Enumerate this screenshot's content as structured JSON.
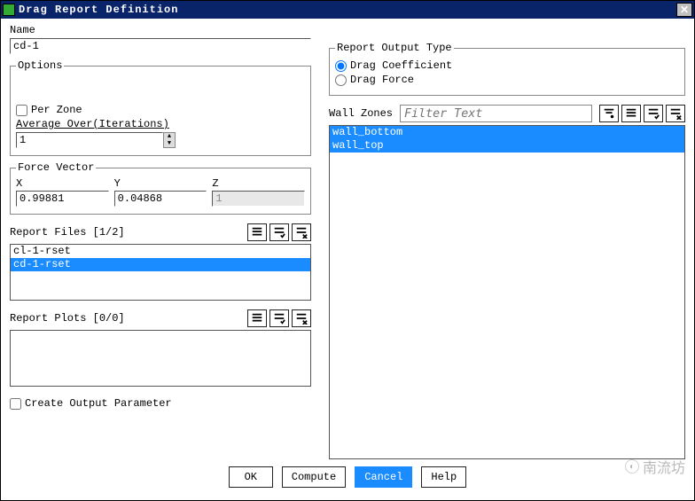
{
  "window": {
    "title": "Drag Report Definition"
  },
  "name": {
    "label": "Name",
    "value": "cd-1"
  },
  "options": {
    "legend": "Options",
    "per_zone_label": "Per Zone",
    "per_zone_checked": false,
    "avg_over_label": "Average Over(Iterations)",
    "avg_over_value": "1"
  },
  "force_vector": {
    "legend": "Force Vector",
    "x_label": "X",
    "x_value": "0.99881",
    "y_label": "Y",
    "y_value": "0.04868",
    "z_label": "Z",
    "z_value": "1"
  },
  "report_files": {
    "header": "Report Files [1/2]",
    "items": [
      "cl-1-rset",
      "cd-1-rset"
    ],
    "selected_index": 1
  },
  "report_plots": {
    "header": "Report Plots [0/0]",
    "items": []
  },
  "create_output_param": {
    "label": "Create Output Parameter",
    "checked": false
  },
  "output_type": {
    "legend": "Report Output Type",
    "opts": [
      "Drag Coefficient",
      "Drag Force"
    ],
    "selected_index": 0
  },
  "wall_zones": {
    "label": "Wall Zones",
    "filter_placeholder": "Filter Text",
    "items": [
      "wall_bottom",
      "wall_top"
    ],
    "selected": [
      0,
      1
    ]
  },
  "buttons": {
    "ok": "OK",
    "compute": "Compute",
    "cancel": "Cancel",
    "help": "Help"
  },
  "watermark": "南流坊"
}
